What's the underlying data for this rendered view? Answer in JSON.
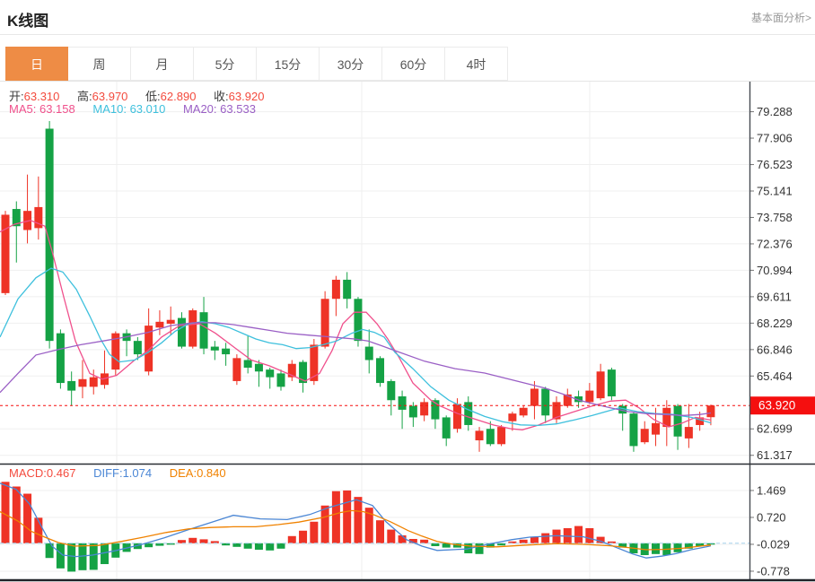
{
  "header": {
    "title": "K线图",
    "link": "基本面分析>"
  },
  "tabs": {
    "items": [
      {
        "name": "day",
        "label": "日",
        "selected": true
      },
      {
        "name": "week",
        "label": "周",
        "selected": false
      },
      {
        "name": "month",
        "label": "月",
        "selected": false
      },
      {
        "name": "5min",
        "label": "5分",
        "selected": false
      },
      {
        "name": "15min",
        "label": "15分",
        "selected": false
      },
      {
        "name": "30min",
        "label": "30分",
        "selected": false
      },
      {
        "name": "60min",
        "label": "60分",
        "selected": false
      },
      {
        "name": "4hour",
        "label": "4时",
        "selected": false
      }
    ]
  },
  "main_info": {
    "open_label": "开:",
    "open": "63.310",
    "high_label": "高:",
    "high": "63.970",
    "low_label": "低:",
    "low": "62.890",
    "close_label": "收:",
    "close": "63.920"
  },
  "ma_info": {
    "ma5_label": "MA5:",
    "ma5": "63.158",
    "ma10_label": "MA10:",
    "ma10": "63.010",
    "ma20_label": "MA20:",
    "ma20": "63.533"
  },
  "macd_info": {
    "macd_label": "MACD:",
    "macd": "0.467",
    "diff_label": "DIFF:",
    "diff": "1.074",
    "dea_label": "DEA:",
    "dea": "0.840"
  },
  "colors": {
    "up_red": "#ee3326",
    "down_green": "#15a245",
    "ma5_pink": "#f0508c",
    "ma10_cyan": "#3ec0dd",
    "ma20_purple": "#9a5fc5",
    "diff_blue": "#4a86d5",
    "dea_orange": "#f08200",
    "tag_red": "#f50f0f",
    "tab_orange": "#ee8c45",
    "grid": "#efefef",
    "axis_line": "#474c52",
    "macd_zero_dash": "#a6d2ee",
    "axis_text": "#333333"
  },
  "chart_data": {
    "type": "candlestick",
    "title": "K线图 日K with MA5/MA10/MA20 and MACD",
    "legend": [
      "MA5",
      "MA10",
      "MA20",
      "MACD",
      "DIFF",
      "DEA"
    ],
    "price_axis_range": [
      60.9,
      81.0
    ],
    "price_ticks": [
      "79.288",
      "77.906",
      "76.523",
      "75.141",
      "73.758",
      "72.376",
      "70.994",
      "69.611",
      "68.229",
      "66.846",
      "65.464",
      "62.699",
      "61.317"
    ],
    "macd_axis_range": [
      -1.1,
      2.2
    ],
    "macd_ticks": [
      "1.469",
      "0.720",
      "-0.029",
      "-0.778"
    ],
    "vertical_gridlines": [
      130,
      403,
      657
    ],
    "price_line": {
      "value": 63.92,
      "label": "63.920"
    },
    "candles": [
      [
        69.8,
        74.1,
        69.7,
        73.9
      ],
      [
        74.2,
        74.6,
        71.4,
        73.3
      ],
      [
        73.1,
        76.0,
        72.4,
        74.1
      ],
      [
        73.2,
        75.9,
        72.6,
        74.3
      ],
      [
        78.4,
        78.8,
        66.9,
        67.3
      ],
      [
        67.7,
        67.9,
        64.8,
        65.1
      ],
      [
        65.2,
        65.7,
        63.9,
        64.7
      ],
      [
        64.9,
        66.3,
        64.3,
        65.3
      ],
      [
        64.9,
        65.8,
        64.5,
        65.4
      ],
      [
        65.0,
        66.8,
        64.8,
        65.6
      ],
      [
        65.8,
        67.8,
        65.5,
        67.7
      ],
      [
        67.7,
        67.9,
        66.5,
        67.3
      ],
      [
        67.3,
        67.5,
        66.3,
        66.6
      ],
      [
        65.7,
        69.0,
        65.5,
        68.1
      ],
      [
        68.0,
        68.9,
        67.6,
        68.3
      ],
      [
        68.2,
        69.1,
        67.6,
        68.4
      ],
      [
        68.5,
        68.8,
        66.9,
        67.0
      ],
      [
        67.0,
        69.0,
        66.9,
        68.9
      ],
      [
        68.8,
        69.6,
        66.6,
        66.9
      ],
      [
        67.0,
        67.3,
        66.3,
        66.8
      ],
      [
        66.9,
        67.2,
        66.0,
        66.6
      ],
      [
        65.2,
        66.6,
        65.0,
        66.4
      ],
      [
        66.3,
        67.6,
        65.6,
        65.9
      ],
      [
        66.1,
        66.3,
        64.9,
        65.7
      ],
      [
        65.8,
        65.9,
        64.8,
        65.4
      ],
      [
        65.6,
        65.8,
        64.7,
        64.9
      ],
      [
        65.4,
        66.3,
        65.2,
        66.1
      ],
      [
        66.2,
        66.3,
        64.6,
        65.1
      ],
      [
        65.2,
        67.4,
        65.0,
        67.1
      ],
      [
        67.0,
        69.9,
        66.9,
        69.5
      ],
      [
        69.5,
        70.7,
        68.6,
        70.5
      ],
      [
        70.5,
        70.9,
        69.0,
        69.5
      ],
      [
        69.5,
        69.6,
        67.0,
        67.3
      ],
      [
        67.0,
        67.9,
        65.6,
        66.3
      ],
      [
        66.4,
        66.5,
        64.9,
        65.1
      ],
      [
        65.2,
        65.3,
        63.4,
        64.2
      ],
      [
        64.4,
        64.7,
        62.7,
        63.7
      ],
      [
        63.9,
        64.1,
        62.8,
        63.3
      ],
      [
        63.4,
        64.3,
        63.1,
        64.1
      ],
      [
        64.2,
        64.3,
        62.7,
        63.2
      ],
      [
        63.3,
        63.4,
        61.8,
        62.2
      ],
      [
        62.7,
        64.3,
        62.5,
        64.0
      ],
      [
        64.1,
        64.4,
        62.6,
        62.9
      ],
      [
        62.1,
        62.8,
        61.5,
        62.6
      ],
      [
        62.7,
        63.1,
        61.8,
        61.9
      ],
      [
        61.9,
        62.9,
        61.8,
        62.8
      ],
      [
        63.1,
        63.6,
        62.6,
        63.5
      ],
      [
        63.4,
        63.9,
        63.3,
        63.8
      ],
      [
        63.9,
        65.2,
        63.2,
        64.8
      ],
      [
        64.8,
        64.9,
        63.0,
        63.4
      ],
      [
        63.2,
        64.4,
        63.0,
        64.1
      ],
      [
        63.9,
        64.8,
        63.8,
        64.5
      ],
      [
        64.4,
        64.7,
        63.8,
        64.1
      ],
      [
        64.1,
        65.1,
        64.0,
        64.7
      ],
      [
        64.3,
        66.1,
        64.2,
        65.7
      ],
      [
        65.8,
        65.9,
        64.2,
        64.4
      ],
      [
        63.9,
        64.0,
        62.6,
        63.5
      ],
      [
        63.5,
        63.6,
        61.5,
        61.8
      ],
      [
        62.0,
        63.1,
        61.9,
        62.7
      ],
      [
        62.4,
        63.8,
        61.8,
        63.0
      ],
      [
        62.8,
        64.2,
        61.8,
        63.8
      ],
      [
        63.9,
        64.0,
        61.6,
        62.3
      ],
      [
        62.2,
        64.0,
        61.7,
        62.8
      ],
      [
        62.9,
        63.6,
        62.6,
        63.3
      ],
      [
        63.31,
        63.97,
        62.89,
        63.92
      ]
    ],
    "ma5_points": [
      [
        0,
        73.0
      ],
      [
        16,
        73.4
      ],
      [
        34,
        73.6
      ],
      [
        50,
        73.3
      ],
      [
        58,
        72.0
      ],
      [
        71,
        69.6
      ],
      [
        84,
        67.3
      ],
      [
        100,
        65.6
      ],
      [
        114,
        65.3
      ],
      [
        130,
        65.5
      ],
      [
        150,
        66.3
      ],
      [
        165,
        66.8
      ],
      [
        180,
        67.5
      ],
      [
        200,
        68.1
      ],
      [
        222,
        68.2
      ],
      [
        240,
        67.7
      ],
      [
        260,
        67.0
      ],
      [
        280,
        66.3
      ],
      [
        300,
        66.0
      ],
      [
        320,
        65.6
      ],
      [
        340,
        65.2
      ],
      [
        356,
        65.6
      ],
      [
        370,
        66.8
      ],
      [
        382,
        68.2
      ],
      [
        395,
        68.8
      ],
      [
        408,
        68.8
      ],
      [
        420,
        68.2
      ],
      [
        432,
        67.4
      ],
      [
        445,
        66.4
      ],
      [
        460,
        65.1
      ],
      [
        480,
        64.2
      ],
      [
        490,
        63.9
      ],
      [
        510,
        63.5
      ],
      [
        530,
        63.2
      ],
      [
        550,
        62.9
      ],
      [
        570,
        62.7
      ],
      [
        582,
        62.65
      ],
      [
        600,
        62.9
      ],
      [
        620,
        63.3
      ],
      [
        640,
        63.6
      ],
      [
        660,
        63.9
      ],
      [
        680,
        64.15
      ],
      [
        697,
        64.2
      ],
      [
        712,
        63.8
      ],
      [
        728,
        63.2
      ],
      [
        745,
        62.8
      ],
      [
        760,
        63.0
      ],
      [
        775,
        63.3
      ],
      [
        792,
        63.16
      ]
    ],
    "ma10_points": [
      [
        0,
        67.5
      ],
      [
        20,
        69.5
      ],
      [
        40,
        70.6
      ],
      [
        57,
        71.1
      ],
      [
        70,
        70.9
      ],
      [
        85,
        70.0
      ],
      [
        100,
        68.6
      ],
      [
        112,
        67.4
      ],
      [
        122,
        66.6
      ],
      [
        133,
        66.2
      ],
      [
        150,
        66.3
      ],
      [
        165,
        66.7
      ],
      [
        180,
        67.2
      ],
      [
        195,
        67.8
      ],
      [
        210,
        68.2
      ],
      [
        225,
        68.3
      ],
      [
        240,
        68.2
      ],
      [
        255,
        68.0
      ],
      [
        270,
        67.7
      ],
      [
        285,
        67.4
      ],
      [
        300,
        67.2
      ],
      [
        315,
        67.1
      ],
      [
        330,
        66.9
      ],
      [
        345,
        66.95
      ],
      [
        360,
        67.1
      ],
      [
        375,
        67.3
      ],
      [
        392,
        67.7
      ],
      [
        404,
        67.9
      ],
      [
        417,
        67.75
      ],
      [
        428,
        67.5
      ],
      [
        440,
        66.7
      ],
      [
        460,
        65.85
      ],
      [
        480,
        64.9
      ],
      [
        500,
        64.2
      ],
      [
        520,
        63.74
      ],
      [
        540,
        63.35
      ],
      [
        560,
        63.07
      ],
      [
        580,
        62.91
      ],
      [
        600,
        62.88
      ],
      [
        620,
        62.96
      ],
      [
        640,
        63.17
      ],
      [
        660,
        63.4
      ],
      [
        675,
        63.6
      ],
      [
        690,
        63.8
      ],
      [
        710,
        63.6
      ],
      [
        730,
        63.5
      ],
      [
        750,
        63.45
      ],
      [
        770,
        63.3
      ],
      [
        782,
        63.15
      ],
      [
        792,
        63.01
      ]
    ],
    "ma20_points": [
      [
        0,
        64.6
      ],
      [
        20,
        65.6
      ],
      [
        40,
        66.56
      ],
      [
        65,
        66.85
      ],
      [
        90,
        67.1
      ],
      [
        115,
        67.3
      ],
      [
        140,
        67.5
      ],
      [
        165,
        67.75
      ],
      [
        190,
        68.1
      ],
      [
        215,
        68.25
      ],
      [
        240,
        68.25
      ],
      [
        260,
        68.15
      ],
      [
        280,
        68.0
      ],
      [
        300,
        67.85
      ],
      [
        320,
        67.7
      ],
      [
        345,
        67.6
      ],
      [
        370,
        67.5
      ],
      [
        395,
        67.4
      ],
      [
        410,
        67.3
      ],
      [
        425,
        67.05
      ],
      [
        440,
        66.79
      ],
      [
        473,
        66.24
      ],
      [
        507,
        65.85
      ],
      [
        540,
        65.62
      ],
      [
        573,
        65.23
      ],
      [
        607,
        64.83
      ],
      [
        627,
        64.52
      ],
      [
        645,
        64.2
      ],
      [
        662,
        64.0
      ],
      [
        680,
        63.8
      ],
      [
        700,
        63.6
      ],
      [
        720,
        63.5
      ],
      [
        740,
        63.45
      ],
      [
        762,
        63.4
      ],
      [
        780,
        63.45
      ],
      [
        792,
        63.53
      ]
    ],
    "macd_bars": [
      1.71,
      1.58,
      1.38,
      0.71,
      -0.41,
      -0.7,
      -0.79,
      -0.75,
      -0.74,
      -0.58,
      -0.4,
      -0.24,
      -0.16,
      -0.11,
      -0.07,
      -0.04,
      0.09,
      0.15,
      0.11,
      0.06,
      -0.06,
      -0.1,
      -0.15,
      -0.18,
      -0.2,
      -0.15,
      0.2,
      0.35,
      0.6,
      1.05,
      1.45,
      1.47,
      1.29,
      0.99,
      0.64,
      0.38,
      0.22,
      0.12,
      0.1,
      -0.08,
      -0.12,
      -0.12,
      -0.28,
      -0.3,
      -0.12,
      -0.06,
      0.05,
      0.1,
      0.18,
      0.28,
      0.38,
      0.42,
      0.48,
      0.42,
      0.18,
      0.05,
      -0.12,
      -0.28,
      -0.33,
      -0.3,
      -0.33,
      -0.25,
      -0.15,
      -0.08,
      -0.03
    ],
    "diff_points": [
      [
        0,
        1.67
      ],
      [
        18,
        1.5
      ],
      [
        33,
        1.09
      ],
      [
        48,
        0.38
      ],
      [
        58,
        -0.08
      ],
      [
        70,
        -0.33
      ],
      [
        85,
        -0.37
      ],
      [
        103,
        -0.33
      ],
      [
        130,
        -0.2
      ],
      [
        157,
        -0.04
      ],
      [
        183,
        0.15
      ],
      [
        210,
        0.38
      ],
      [
        235,
        0.58
      ],
      [
        260,
        0.78
      ],
      [
        290,
        0.68
      ],
      [
        320,
        0.66
      ],
      [
        345,
        0.8
      ],
      [
        367,
        1.0
      ],
      [
        397,
        1.21
      ],
      [
        415,
        1.05
      ],
      [
        430,
        0.6
      ],
      [
        453,
        0.1
      ],
      [
        470,
        -0.08
      ],
      [
        487,
        -0.2
      ],
      [
        520,
        -0.16
      ],
      [
        545,
        -0.02
      ],
      [
        570,
        0.1
      ],
      [
        590,
        0.17
      ],
      [
        620,
        0.21
      ],
      [
        650,
        0.18
      ],
      [
        670,
        0.05
      ],
      [
        687,
        -0.12
      ],
      [
        705,
        -0.3
      ],
      [
        720,
        -0.41
      ],
      [
        737,
        -0.36
      ],
      [
        753,
        -0.29
      ],
      [
        770,
        -0.18
      ],
      [
        787,
        -0.1
      ],
      [
        792,
        -0.07
      ]
    ],
    "dea_points": [
      [
        0,
        0.88
      ],
      [
        20,
        0.62
      ],
      [
        35,
        0.33
      ],
      [
        50,
        0.17
      ],
      [
        65,
        0.02
      ],
      [
        83,
        -0.08
      ],
      [
        110,
        -0.06
      ],
      [
        135,
        0.05
      ],
      [
        160,
        0.17
      ],
      [
        185,
        0.3
      ],
      [
        210,
        0.4
      ],
      [
        235,
        0.44
      ],
      [
        260,
        0.46
      ],
      [
        285,
        0.46
      ],
      [
        310,
        0.52
      ],
      [
        333,
        0.59
      ],
      [
        360,
        0.72
      ],
      [
        380,
        0.86
      ],
      [
        392,
        0.91
      ],
      [
        405,
        0.88
      ],
      [
        417,
        0.79
      ],
      [
        435,
        0.6
      ],
      [
        455,
        0.35
      ],
      [
        470,
        0.2
      ],
      [
        487,
        0.05
      ],
      [
        505,
        -0.03
      ],
      [
        525,
        -0.08
      ],
      [
        553,
        -0.1
      ],
      [
        587,
        -0.05
      ],
      [
        620,
        -0.01
      ],
      [
        650,
        -0.03
      ],
      [
        680,
        -0.07
      ],
      [
        700,
        -0.12
      ],
      [
        720,
        -0.18
      ],
      [
        740,
        -0.17
      ],
      [
        760,
        -0.14
      ],
      [
        780,
        -0.08
      ],
      [
        792,
        -0.05
      ]
    ]
  }
}
